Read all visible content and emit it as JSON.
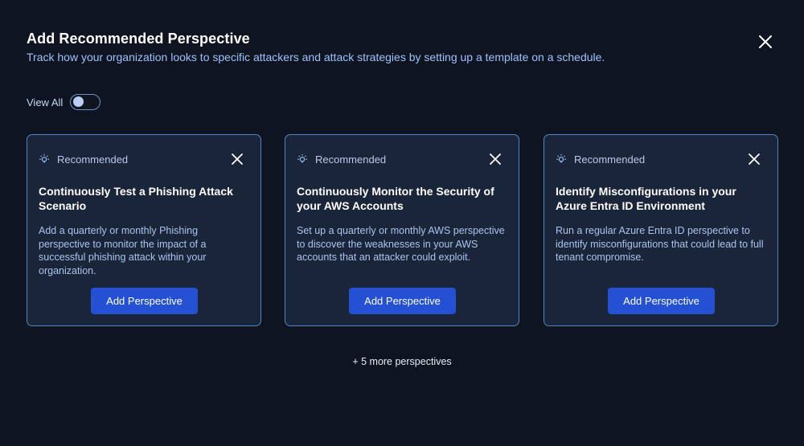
{
  "header": {
    "title": "Add Recommended Perspective",
    "subtitle": "Track how your organization looks to specific attackers and attack strategies by setting up a template on a schedule."
  },
  "view_all": {
    "label": "View All",
    "enabled": false
  },
  "cards": [
    {
      "tag": "Recommended",
      "title": "Continuously Test a Phishing Attack Scenario",
      "description": "Add a quarterly or monthly Phishing perspective to monitor the impact of a successful phishing attack within your organization.",
      "button": "Add Perspective"
    },
    {
      "tag": "Recommended",
      "title": "Continuously Monitor the Security of your AWS Accounts",
      "description": "Set up a quarterly or monthly AWS perspective to discover the weaknesses in your AWS accounts that an attacker could exploit.",
      "button": "Add Perspective"
    },
    {
      "tag": "Recommended",
      "title": "Identify Misconfigurations in your Azure Entra ID Environment",
      "description": "Run a regular Azure Entra ID perspective to identify misconfigurations that could lead to full tenant compromise.",
      "button": "Add Perspective"
    }
  ],
  "more_link": "+ 5 more perspectives",
  "icons": {
    "close": "close-icon",
    "bulb": "lightbulb-icon"
  },
  "colors": {
    "background": "#0f1520",
    "card_background": "#1b2539",
    "card_border": "#4a86c8",
    "accent_button": "#2450d4",
    "subtitle_text": "#9cc0ff"
  }
}
